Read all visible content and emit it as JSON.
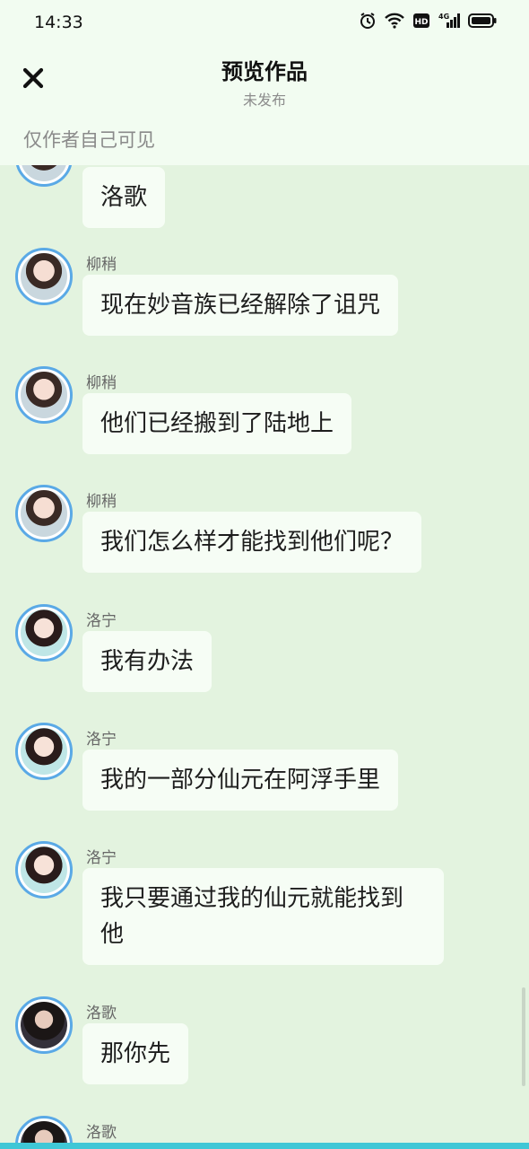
{
  "status_bar": {
    "time": "14:33",
    "icons": [
      "alarm-icon",
      "wifi-icon",
      "hd-icon",
      "signal-4g-icon",
      "battery-icon"
    ],
    "hd_label": "HD",
    "network_label": "4G"
  },
  "header": {
    "close_icon": "close-icon",
    "title": "预览作品",
    "subtitle": "未发布",
    "visibility_note": "仅作者自己可见"
  },
  "messages": [
    {
      "sender": "",
      "text": "洛歌",
      "avatar": "luoge"
    },
    {
      "sender": "柳稍",
      "text": "现在妙音族已经解除了诅咒",
      "avatar": "liushao"
    },
    {
      "sender": "柳稍",
      "text": "他们已经搬到了陆地上",
      "avatar": "liushao"
    },
    {
      "sender": "柳稍",
      "text": "我们怎么样才能找到他们呢？",
      "avatar": "liushao"
    },
    {
      "sender": "洛宁",
      "text": "我有办法",
      "avatar": "luoning"
    },
    {
      "sender": "洛宁",
      "text": "我的一部分仙元在阿浮手里",
      "avatar": "luoning"
    },
    {
      "sender": "洛宁",
      "text": "我只要通过我的仙元就能找到他",
      "avatar": "luoning"
    },
    {
      "sender": "洛歌",
      "text": "那你先",
      "avatar": "luoge"
    },
    {
      "sender": "洛歌",
      "text": "",
      "avatar": "luoge"
    }
  ],
  "colors": {
    "background": "#e3f3df",
    "header_background": "#f2fcf1",
    "bubble": "#f6fdf5",
    "avatar_border": "#5aa9e6",
    "bottom_accent": "#3fc7d6"
  }
}
